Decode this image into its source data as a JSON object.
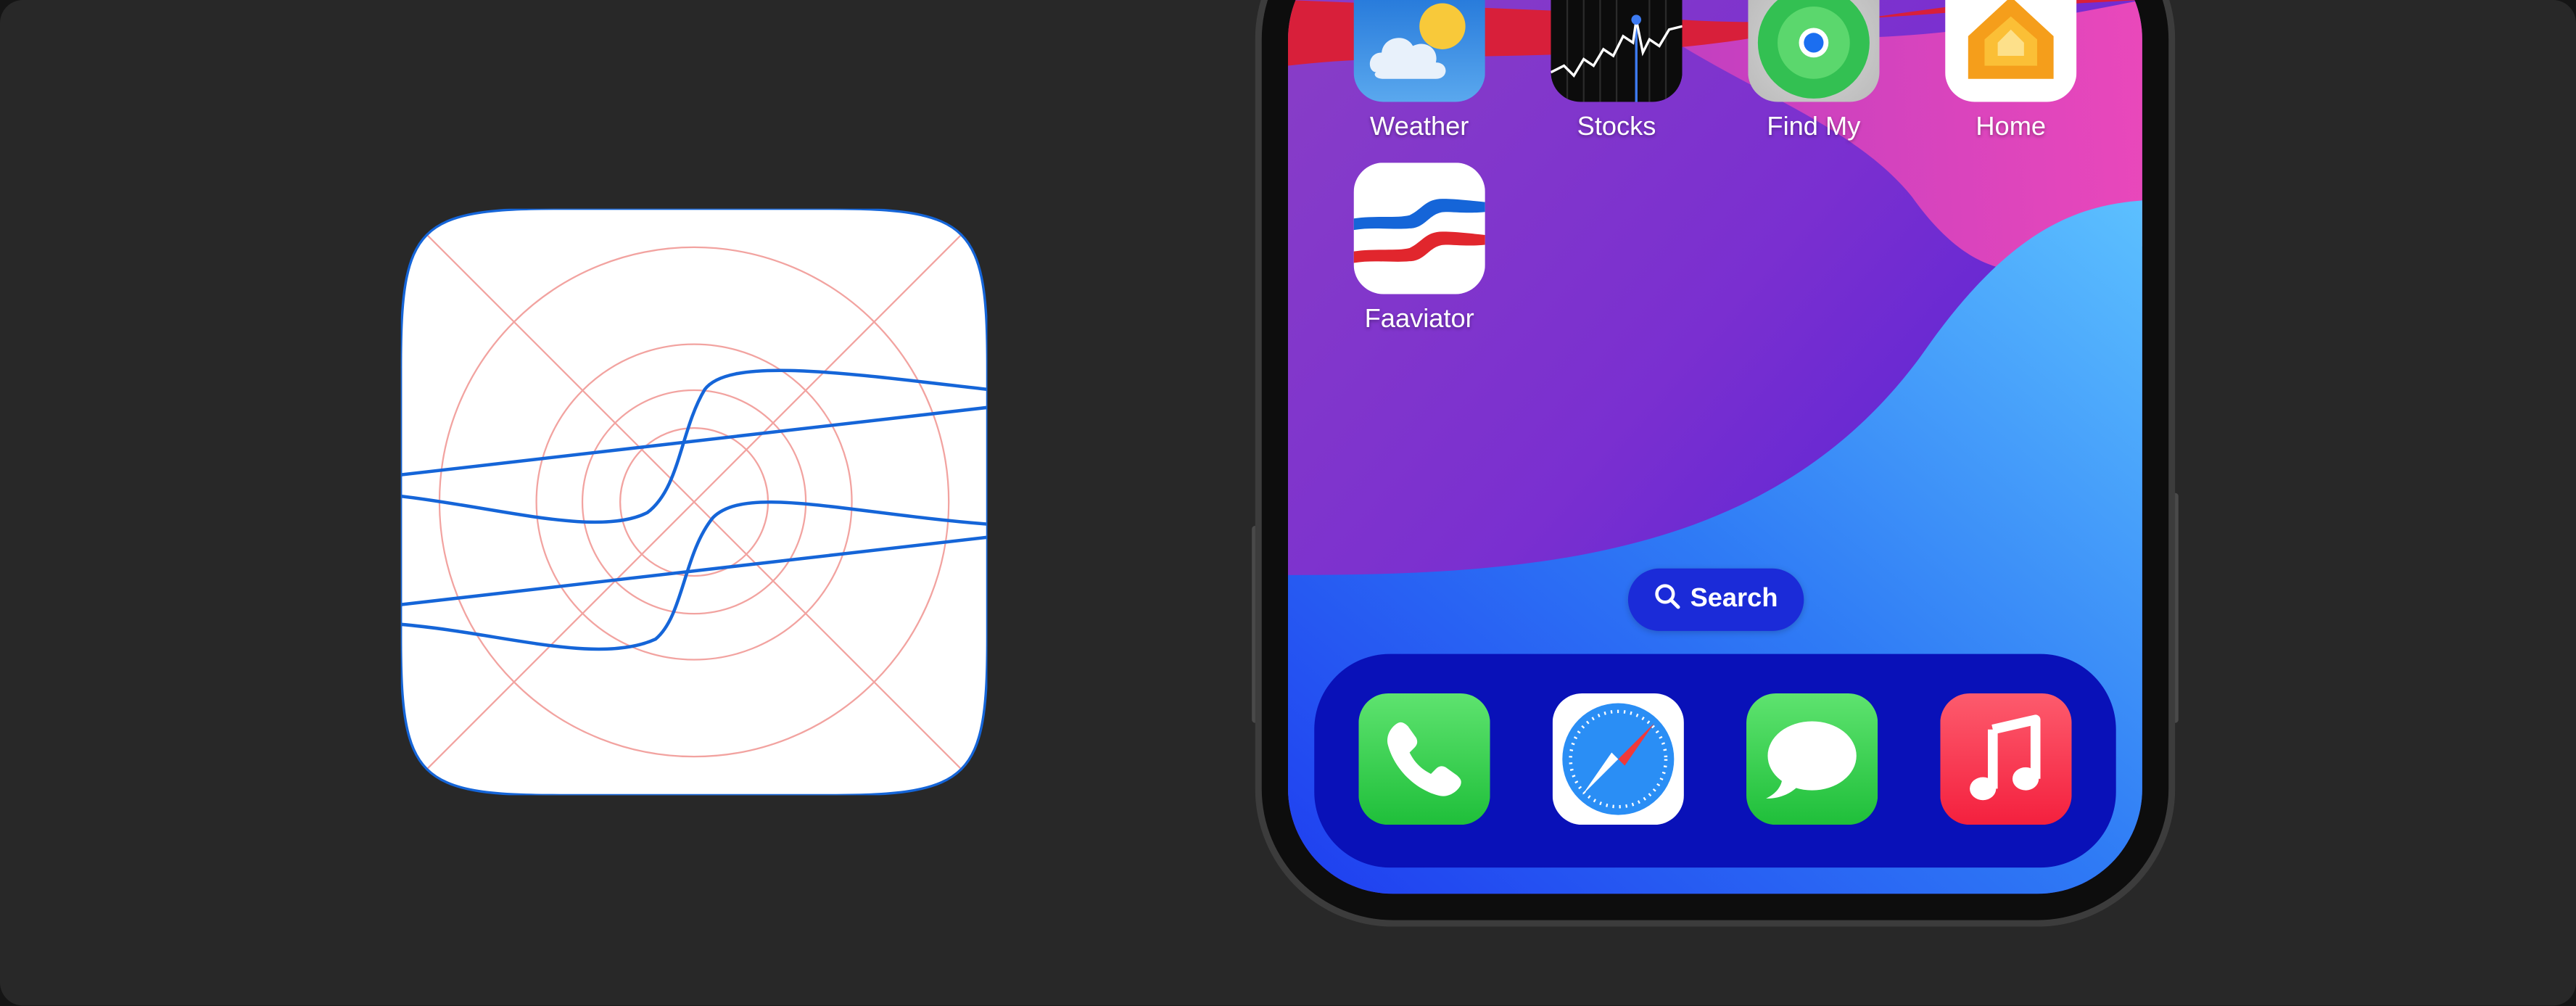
{
  "home_screen": {
    "top_row": [
      {
        "label": "Weather",
        "icon": "weather-icon"
      },
      {
        "label": "Stocks",
        "icon": "stocks-icon"
      },
      {
        "label": "Find My",
        "icon": "find-my-icon"
      },
      {
        "label": "Home",
        "icon": "home-icon"
      }
    ],
    "second_row": [
      {
        "label": "Faaviator",
        "icon": "faaviator-icon"
      }
    ],
    "search": {
      "label": "Search",
      "icon": "search-icon"
    },
    "dock": [
      {
        "icon": "phone-icon"
      },
      {
        "icon": "safari-icon"
      },
      {
        "icon": "messages-icon"
      },
      {
        "icon": "music-icon"
      }
    ]
  },
  "colors": {
    "background": "#282828",
    "icon_stroke": "#1565d8",
    "grid_lines": "#f2a3a0",
    "accent_red": "#e1262d",
    "dock": "#0911b8"
  }
}
